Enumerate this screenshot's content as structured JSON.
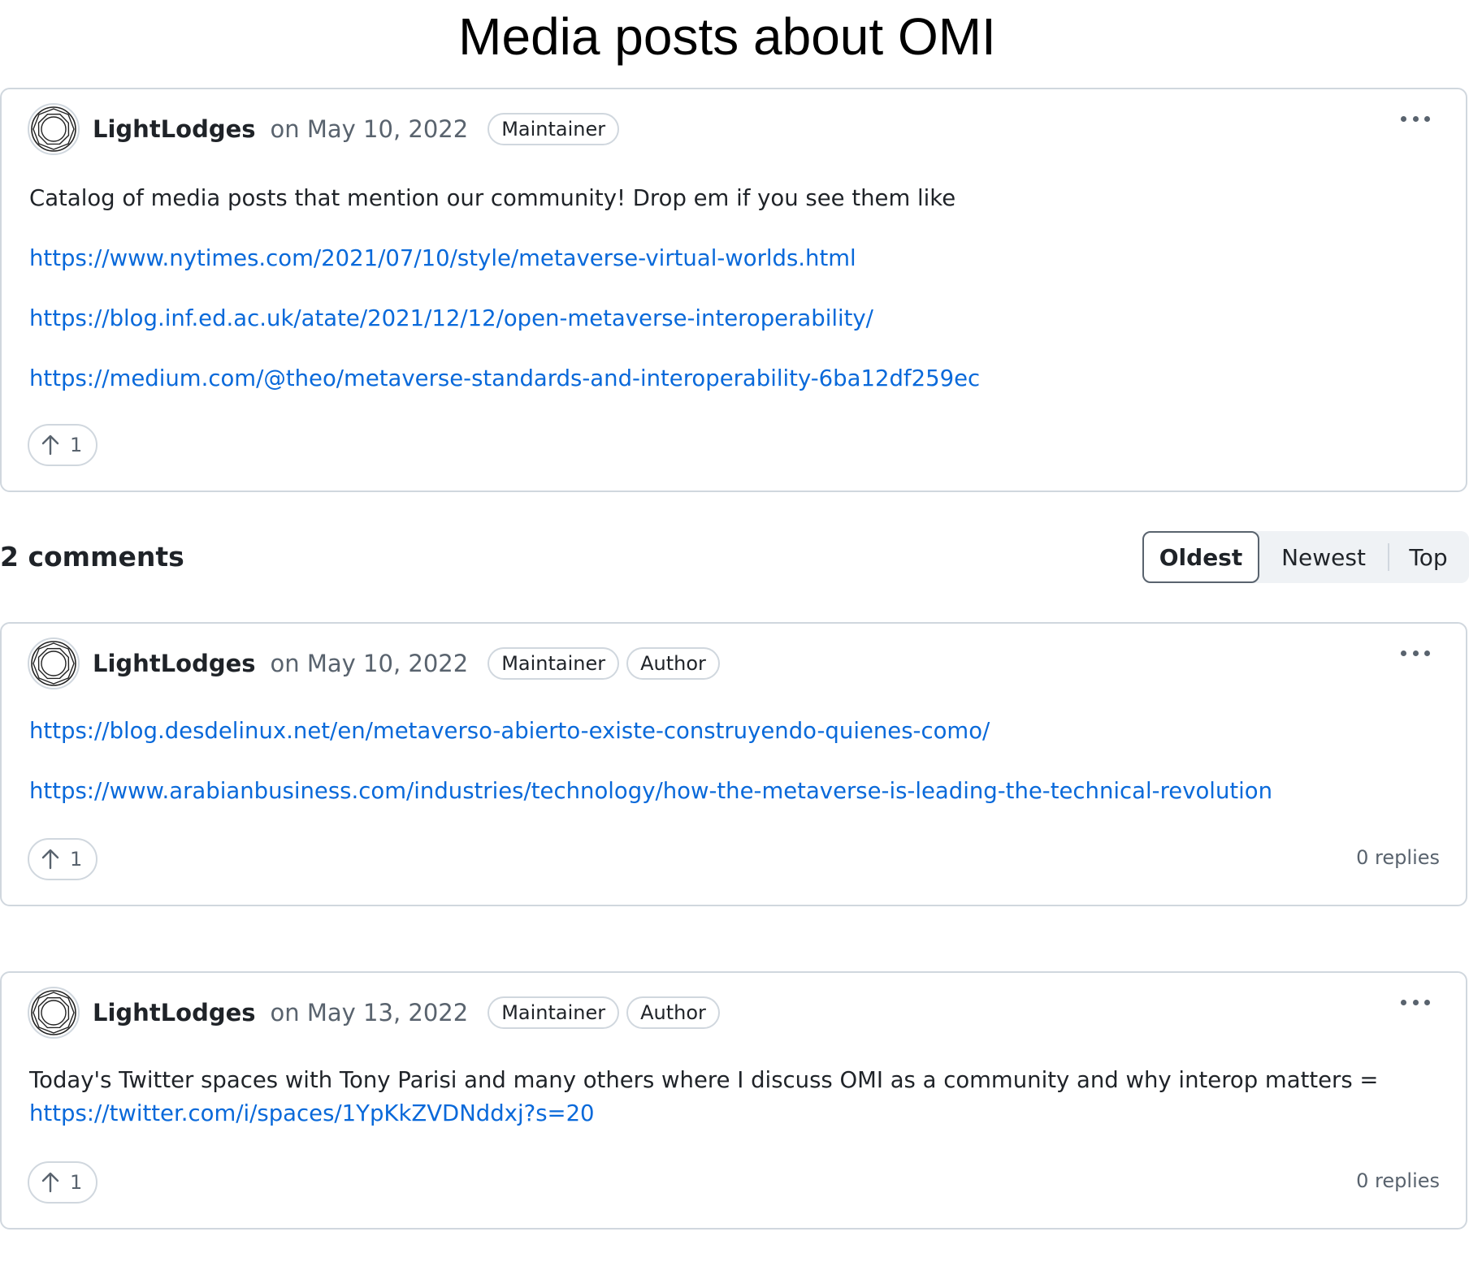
{
  "page_title": "Media posts about OMI",
  "post": {
    "author": "LightLodges",
    "date": "on May 10, 2022",
    "badges": [
      "Maintainer"
    ],
    "text": "Catalog of media posts that mention our community! Drop em if you see them like",
    "links": [
      "https://www.nytimes.com/2021/07/10/style/metaverse-virtual-worlds.html",
      "https://blog.inf.ed.ac.uk/atate/2021/12/12/open-metaverse-interoperability/",
      "https://medium.com/@theo/metaverse-standards-and-interoperability-6ba12df259ec"
    ],
    "upvotes": "1"
  },
  "comments_header": {
    "count_label": "2 comments",
    "sort_options": [
      "Oldest",
      "Newest",
      "Top"
    ],
    "selected_sort": "Oldest"
  },
  "comments": [
    {
      "author": "LightLodges",
      "date": "on May 10, 2022",
      "badges": [
        "Maintainer",
        "Author"
      ],
      "links": [
        "https://blog.desdelinux.net/en/metaverso-abierto-existe-construyendo-quienes-como/",
        "https://www.arabianbusiness.com/industries/technology/how-the-metaverse-is-leading-the-technical-revolution"
      ],
      "upvotes": "1",
      "replies": "0 replies"
    },
    {
      "author": "LightLodges",
      "date": "on May 13, 2022",
      "badges": [
        "Maintainer",
        "Author"
      ],
      "text": "Today's Twitter spaces with Tony Parisi and many others where I discuss OMI as a community and why interop matters =",
      "links": [
        "https://twitter.com/i/spaces/1YpKkZVDNddxj?s=20"
      ],
      "upvotes": "1",
      "replies": "0 replies"
    }
  ],
  "icons": {
    "avatar": "octagon-logo-avatar",
    "kebab": "kebab-horizontal-icon",
    "upvote": "arrow-up-icon"
  },
  "colors": {
    "link": "#0969da",
    "muted": "#59636e",
    "border": "#d0d7de"
  }
}
